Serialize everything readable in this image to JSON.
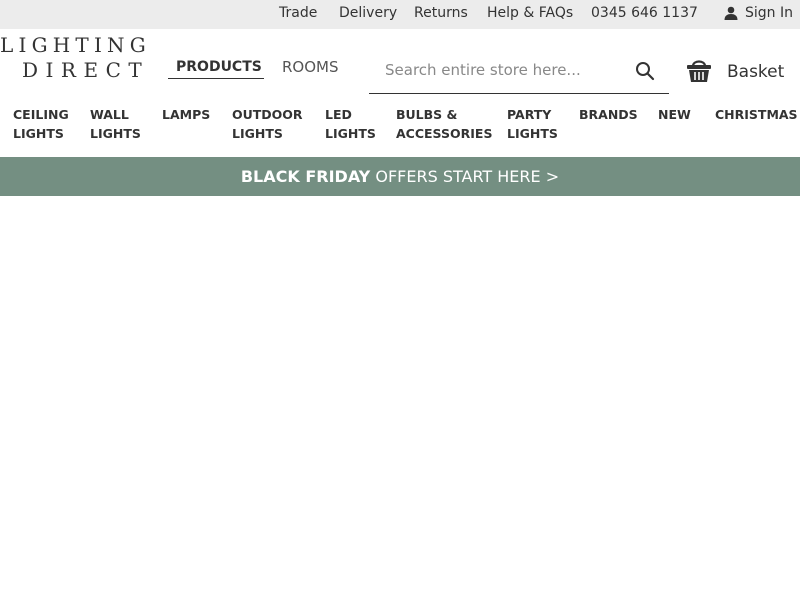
{
  "topbar": {
    "trade": "Trade",
    "delivery": "Delivery",
    "returns": "Returns",
    "help": "Help & FAQs",
    "phone": "0345 646 1137",
    "sign_in": "Sign In"
  },
  "logo": {
    "line1": "LIGHTING",
    "line2": "DIRECT"
  },
  "tabs": {
    "products": "PRODUCTS",
    "rooms": "ROOMS"
  },
  "search": {
    "placeholder": "Search entire store here..."
  },
  "basket": {
    "label": "Basket"
  },
  "nav": [
    {
      "l1": "CEILING",
      "l2": "LIGHTS"
    },
    {
      "l1": "WALL",
      "l2": "LIGHTS"
    },
    {
      "l1": "LAMPS",
      "l2": ""
    },
    {
      "l1": "OUTDOOR",
      "l2": "LIGHTS"
    },
    {
      "l1": "LED",
      "l2": "LIGHTS"
    },
    {
      "l1": "BULBS &",
      "l2": "ACCESSORIES"
    },
    {
      "l1": "PARTY",
      "l2": "LIGHTS"
    },
    {
      "l1": "BRANDS",
      "l2": ""
    },
    {
      "l1": "NEW",
      "l2": ""
    },
    {
      "l1": "CHRISTMAS",
      "l2": ""
    }
  ],
  "promo": {
    "bold": "BLACK FRIDAY",
    "rest": "OFFERS START HERE >"
  },
  "colors": {
    "topbar_bg": "#ececec",
    "promo_bg": "#748f82",
    "text": "#333333"
  }
}
